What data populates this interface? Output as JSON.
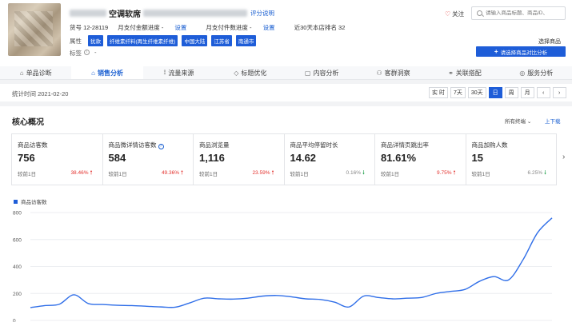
{
  "product": {
    "title": "空调软席",
    "rating_link": "评分说明",
    "sku": "货号 12-28119",
    "pay_progress_label": "月支付金额进度 -",
    "pay_progress_link": "设置",
    "pay_count_label": "月支付件数进度 -",
    "pay_count_link": "设置",
    "rank": "近30天本店排名 32",
    "attr_label": "属性",
    "tags": [
      "犹款",
      "纤维素纤料(再生纤维素纤维)",
      "中国大陆",
      "江苏省",
      "南通市"
    ],
    "tag2_label": "标签",
    "tag2_value": "-"
  },
  "header_actions": {
    "follow_label": "关注",
    "search_placeholder": "请输入商品标题、商品ID、",
    "compare_label": "选择商品",
    "compare_button": "请选择商品对比分析"
  },
  "tabs": [
    {
      "label": "单品诊断",
      "icon": "diagnosis-icon"
    },
    {
      "label": "销售分析",
      "icon": "sales-icon",
      "active": true
    },
    {
      "label": "流量来源",
      "icon": "traffic-icon"
    },
    {
      "label": "标题优化",
      "icon": "title-icon"
    },
    {
      "label": "内容分析",
      "icon": "content-icon"
    },
    {
      "label": "客群洞察",
      "icon": "audience-icon"
    },
    {
      "label": "关联搭配",
      "icon": "link-icon"
    },
    {
      "label": "服务分析",
      "icon": "service-icon"
    }
  ],
  "timebar": {
    "stat_time": "统计时间 2021-02-20",
    "ranges": [
      "实 时",
      "7天",
      "30天",
      "日",
      "周",
      "月"
    ],
    "active_range": "日"
  },
  "core": {
    "title": "核心概况",
    "indicator_select": "所有终端",
    "download": "上下载",
    "compare_prefix": "较前1日",
    "metrics": [
      {
        "name": "商品访客数",
        "value": "756",
        "pct": "38.46%",
        "dir": "up"
      },
      {
        "name": "商品微详情访客数",
        "value": "584",
        "pct": "49.36%",
        "dir": "up",
        "help": true
      },
      {
        "name": "商品浏览量",
        "value": "1,116",
        "pct": "23.59%",
        "dir": "up"
      },
      {
        "name": "商品平均停留时长",
        "value": "14.62",
        "pct": "0.16%",
        "dir": "down"
      },
      {
        "name": "商品详情页跳出率",
        "value": "81.61%",
        "pct": "9.75%",
        "dir": "up"
      },
      {
        "name": "商品加购人数",
        "value": "15",
        "pct": "6.25%",
        "dir": "down"
      }
    ]
  },
  "chart_data": {
    "type": "line",
    "series": [
      {
        "name": "商品访客数",
        "values": [
          95,
          110,
          120,
          190,
          125,
          118,
          112,
          110,
          105,
          100,
          98,
          130,
          165,
          160,
          158,
          165,
          180,
          185,
          175,
          160,
          155,
          135,
          100,
          180,
          170,
          160,
          165,
          170,
          200,
          215,
          230,
          290,
          325,
          300,
          450,
          650,
          760
        ]
      }
    ],
    "ylim": [
      0,
      800
    ],
    "yticks": [
      0,
      200,
      400,
      600,
      800
    ],
    "color": "#2f6ee8"
  }
}
